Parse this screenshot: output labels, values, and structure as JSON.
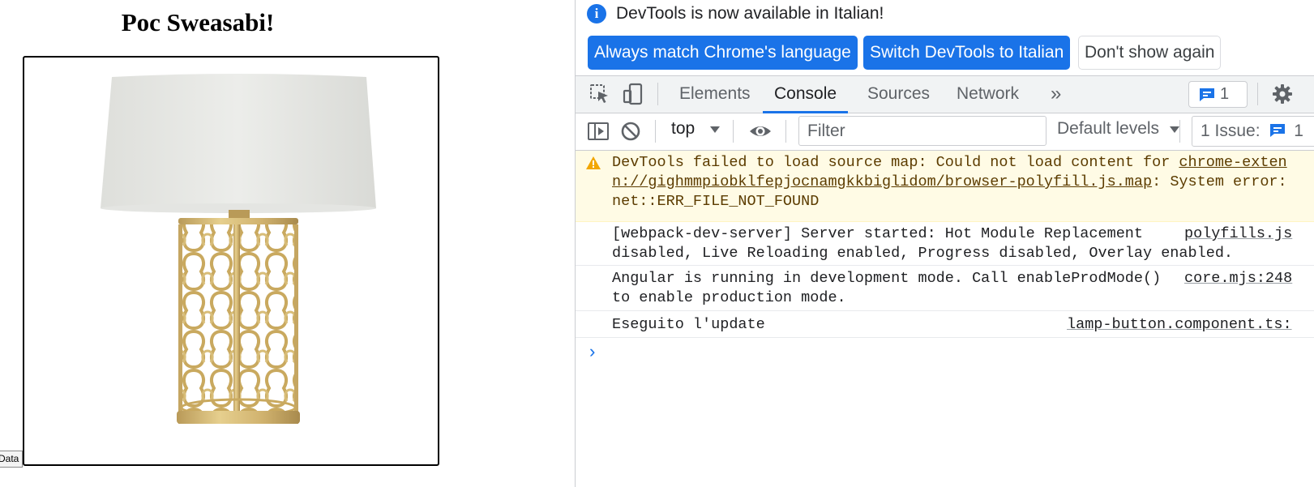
{
  "page": {
    "title": "Poc Sweasabi!",
    "data_tab": "Data"
  },
  "devtools": {
    "infobar": {
      "icon": "info-icon",
      "message": "DevTools is now available in Italian!",
      "btn_match": "Always match Chrome's language",
      "btn_switch": "Switch DevTools to Italian",
      "btn_dont": "Don't show again"
    },
    "tabs": [
      {
        "label": "Elements"
      },
      {
        "label": "Console"
      },
      {
        "label": "Sources"
      },
      {
        "label": "Network"
      }
    ],
    "more_tabs_glyph": "»",
    "issues_count": "1",
    "toolbar": {
      "context": "top",
      "filter_placeholder": "Filter",
      "levels": "Default levels",
      "issues_label": "1 Issue:",
      "issues_count": "1"
    },
    "console": {
      "messages": [
        {
          "level": "warning",
          "line1_prefix": "DevTools failed to load source map: Could not load content for ",
          "line1_link": "chrome-exten",
          "line2_link": "n://gighmmpiobklfepjocnamgkkbiglidom/browser-polyfill.js.map",
          "line2_suffix": ": System error:",
          "line3": "net::ERR_FILE_NOT_FOUND"
        },
        {
          "level": "info",
          "line1": "[webpack-dev-server] Server started: Hot Module Replacement",
          "line2": "disabled, Live Reloading enabled, Progress disabled, Overlay enabled.",
          "source": "polyfills.js"
        },
        {
          "level": "info",
          "line1": "Angular is running in development mode. Call enableProdMode()",
          "line2": "to enable production mode.",
          "source": "core.mjs:248"
        },
        {
          "level": "info",
          "line1": "Eseguito l'update",
          "source": "lamp-button.component.ts:"
        }
      ],
      "prompt_glyph": "›"
    },
    "colors": {
      "accent": "#1a73e8",
      "warning_bg": "#fffbe5",
      "warning_text": "#5c3c00",
      "toolbar_bg": "#f1f3f4"
    }
  }
}
